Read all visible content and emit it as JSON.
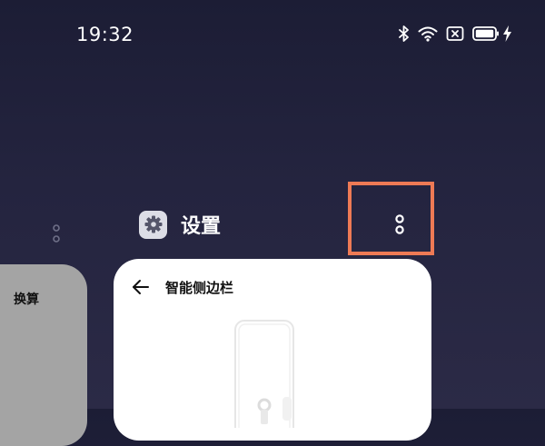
{
  "status_bar": {
    "time": "19:32",
    "icons": [
      "bluetooth-icon",
      "wifi-icon",
      "sim-x-icon",
      "battery-icon",
      "charging-icon"
    ]
  },
  "left_card": {
    "label": "换算"
  },
  "app_card": {
    "app_name": "设置",
    "app_icon": "gear-icon",
    "more_icon": "more-vertical-icon",
    "screen_title": "智能侧边栏",
    "back_icon": "arrow-left-icon"
  },
  "colors": {
    "highlight": "#ee7a55",
    "card_background": "#ffffff",
    "left_card_background": "#a4a4a4"
  }
}
